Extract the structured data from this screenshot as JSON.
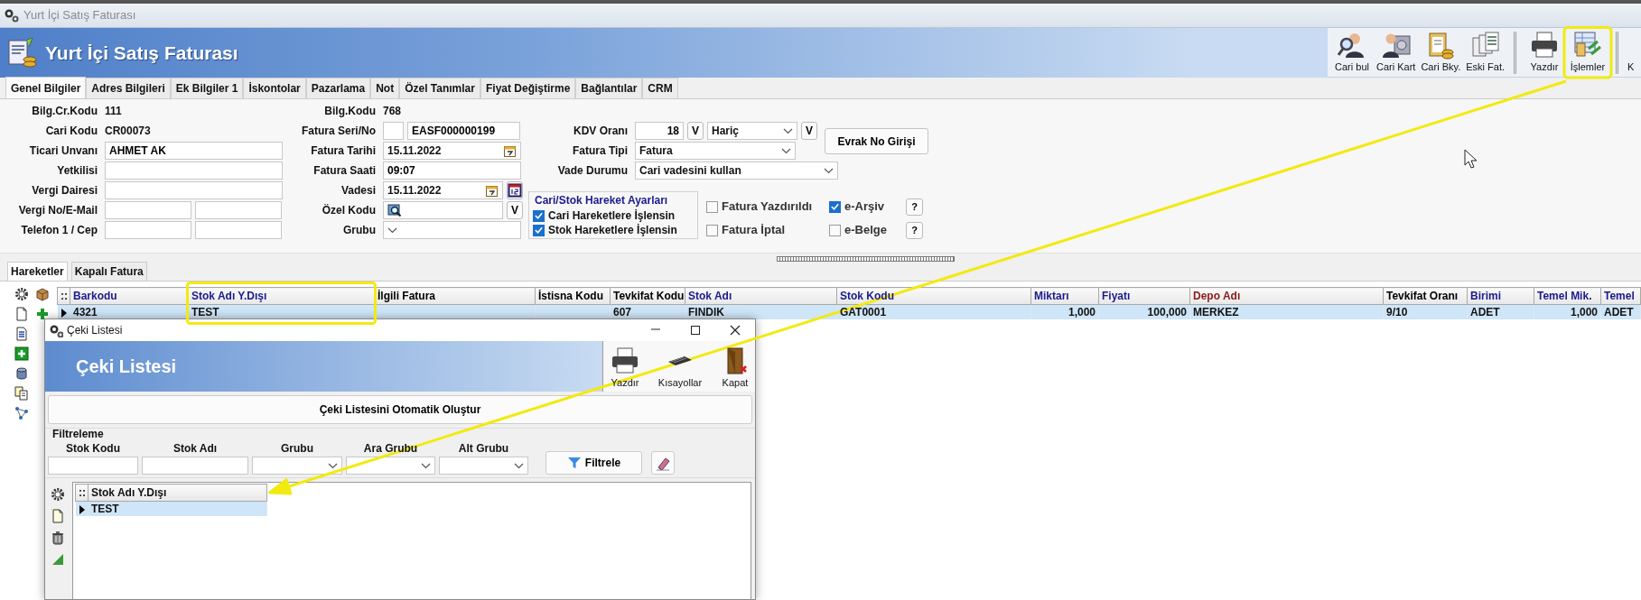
{
  "window": {
    "title": "Yurt İçi Satış Faturası"
  },
  "header": {
    "title": "Yurt İçi Satış Faturası",
    "toolbar_groups": [
      [
        {
          "label": "Cari bul"
        },
        {
          "label": "Cari Kart"
        },
        {
          "label": "Cari Bky."
        },
        {
          "label": "Eski Fat."
        }
      ],
      [
        {
          "label": "Yazdır"
        },
        {
          "label": "İşlemler"
        }
      ],
      [
        {
          "label": "K"
        }
      ]
    ]
  },
  "tabs": [
    {
      "label": "Genel Bilgiler",
      "selected": true
    },
    {
      "label": "Adres Bilgileri",
      "selected": false
    },
    {
      "label": "Ek Bilgiler 1",
      "selected": false
    },
    {
      "label": "İskontolar",
      "selected": false
    },
    {
      "label": "Pazarlama",
      "selected": false
    },
    {
      "label": "Not",
      "selected": false
    },
    {
      "label": "Özel Tanımlar",
      "selected": false
    },
    {
      "label": "Fiyat Değiştirme",
      "selected": false
    },
    {
      "label": "Bağlantılar",
      "selected": false
    },
    {
      "label": "CRM",
      "selected": false
    }
  ],
  "form": {
    "left": [
      {
        "label": "Bilg.Cr.Kodu",
        "kind": "static",
        "value": "111"
      },
      {
        "label": "Cari Kodu",
        "kind": "static",
        "value": "CR00073"
      },
      {
        "label": "Ticari Unvanı",
        "kind": "input",
        "value": "AHMET AK"
      },
      {
        "label": "Yetkilisi",
        "kind": "input"
      },
      {
        "label": "Vergi Dairesi",
        "kind": "input"
      },
      {
        "label": "Vergi No/E-Mail",
        "kind": "pair"
      },
      {
        "label": "Telefon 1 / Cep",
        "kind": "pair"
      }
    ],
    "middle": [
      {
        "label": "Bilg.Kodu",
        "kind": "static",
        "value": "768"
      },
      {
        "label": "Fatura Seri/No",
        "kind": "seri",
        "value": "EASF000000199"
      },
      {
        "label": "Fatura Tarihi",
        "kind": "date",
        "value": "15.11.2022"
      },
      {
        "label": "Fatura Saati",
        "kind": "input",
        "value": "09:07"
      },
      {
        "label": "Vadesi",
        "kind": "date_extra",
        "value": "15.11.2022"
      },
      {
        "label": "Özel Kodu",
        "kind": "lookup",
        "button": "V"
      },
      {
        "label": "Grubu",
        "kind": "select"
      }
    ],
    "right": [
      {
        "label": "KDV Oranı",
        "kind": "kdv",
        "value": "18",
        "button": "V",
        "option": "Hariç",
        "button_2": "V"
      },
      {
        "label": "Fatura Tipi",
        "kind": "select",
        "value": "Fatura"
      },
      {
        "label": "Vade Durumu",
        "kind": "select_wide",
        "value": "Cari vadesini kullan"
      }
    ],
    "evrak_button": "Evrak No Girişi",
    "hareket_group": {
      "title": "Cari/Stok Hareket Ayarları",
      "options": [
        {
          "label": "Cari Hareketlere İşlensin",
          "checked": true
        },
        {
          "label": "Stok Hareketlere İşlensin",
          "checked": true
        }
      ]
    },
    "flags": [
      {
        "label": "Fatura Yazdırıldı",
        "checked": false
      },
      {
        "label": "Fatura İptal",
        "checked": false
      }
    ],
    "e_documents": [
      {
        "label": "e-Arşiv",
        "checked": true,
        "help": "?"
      },
      {
        "label": "e-Belge",
        "checked": false,
        "help": "?"
      }
    ]
  },
  "lower_tabs": [
    {
      "label": "Hareketler",
      "selected": true
    },
    {
      "label": "Kapalı Fatura",
      "selected": false
    }
  ],
  "grid": {
    "row_header": "::",
    "columns": [
      {
        "label": "Barkodu",
        "color": "#1a1a8c"
      },
      {
        "label": "Stok Adı Y.Dışı",
        "color": "#1a1a8c"
      },
      {
        "label": "İlgili Fatura",
        "color": "#000000"
      },
      {
        "label": "İstisna Kodu",
        "color": "#000000"
      },
      {
        "label": "Tevkifat Kodu",
        "color": "#000000"
      },
      {
        "label": "Stok Adı",
        "color": "#1a1a8c"
      },
      {
        "label": "Stok Kodu",
        "color": "#1a1a8c"
      },
      {
        "label": "Miktarı",
        "color": "#1a1a8c",
        "kind": "number"
      },
      {
        "label": "Fiyatı",
        "color": "#1a1a8c",
        "kind": "number"
      },
      {
        "label": "Depo Adı",
        "color": "#8b1a1a"
      },
      {
        "label": "Tevkifat Oranı",
        "color": "#000000"
      },
      {
        "label": "Birimi",
        "color": "#1a1a8c"
      },
      {
        "label": "Temel Mik.",
        "color": "#1a1a8c",
        "kind": "number"
      },
      {
        "label": "Temel",
        "color": "#1a1a8c"
      }
    ],
    "rows": [
      {
        "selected": true,
        "cells": [
          "4321",
          "TEST",
          null,
          null,
          "607",
          "FINDIK",
          "GAT0001",
          "1,000",
          "100,000",
          "MERKEZ",
          "9/10",
          "ADET",
          "1,000",
          "ADET"
        ]
      }
    ]
  },
  "dialog": {
    "title": "Çeki Listesi",
    "header_title": "Çeki Listesi",
    "toolbar": [
      {
        "label": "Yazdır"
      },
      {
        "label": "Kısayollar"
      },
      {
        "label": "Kapat"
      }
    ],
    "action_button": "Çeki Listesini Otomatik Oluştur",
    "filter": {
      "title": "Filtreleme",
      "fields": [
        {
          "label": "Stok Kodu",
          "kind": "input"
        },
        {
          "label": "Stok Adı",
          "kind": "input"
        },
        {
          "label": "Grubu",
          "kind": "select"
        },
        {
          "label": "Ara Grubu",
          "kind": "select"
        },
        {
          "label": "Alt Grubu",
          "kind": "select"
        }
      ],
      "button": "Filtrele"
    },
    "grid": {
      "row_header": "::",
      "columns": [
        {
          "label": "Stok Adı Y.Dışı"
        }
      ],
      "rows": [
        {
          "selected": true,
          "cells": [
            "TEST"
          ]
        }
      ]
    }
  }
}
